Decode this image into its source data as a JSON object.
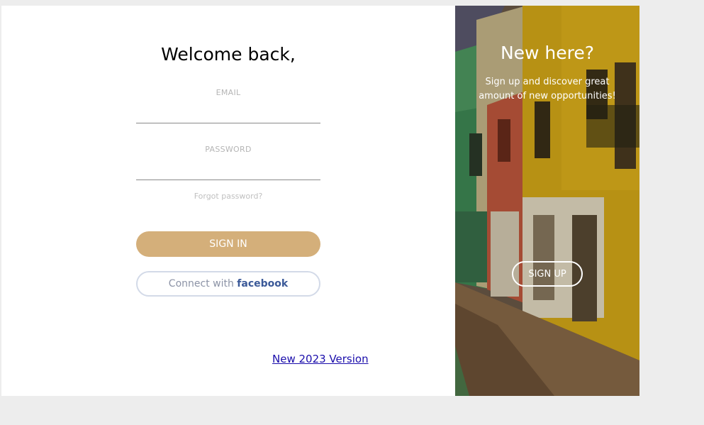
{
  "login": {
    "title": "Welcome back,",
    "email_label": "EMAIL",
    "password_label": "PASSWORD",
    "forgot_password": "Forgot password?",
    "sign_in_label": "SIGN IN",
    "facebook_prefix": "Connect with",
    "facebook_brand": "facebook",
    "version_link": "New 2023 Version"
  },
  "signup_panel": {
    "title": "New here?",
    "text": "Sign up and discover great amount of new opportunities!",
    "button_label": "SIGN UP"
  },
  "colors": {
    "page_background": "#ededed",
    "sign_in_button": "#d4af7a",
    "facebook_brand": "#3b5998",
    "link": "#1a0dab"
  },
  "icons": {
    "panel_background": "colorful-street-photo"
  }
}
